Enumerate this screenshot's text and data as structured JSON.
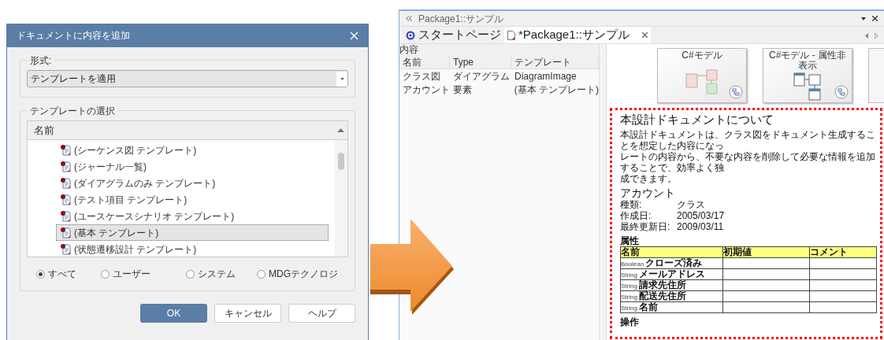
{
  "dialog": {
    "title": "ドキュメントに内容を追加",
    "format_group": {
      "label": "形式:",
      "dropdown_value": "テンプレートを適用"
    },
    "template_group": {
      "label": "テンプレートの選択",
      "column": "名前",
      "items": [
        {
          "label": "(シーケンス図 テンプレート)",
          "selected": false
        },
        {
          "label": "(ジャーナル一覧)",
          "selected": false
        },
        {
          "label": "(ダイアグラムのみ テンプレート)",
          "selected": false
        },
        {
          "label": "(テスト項目 テンプレート)",
          "selected": false
        },
        {
          "label": "(ユースケースシナリオ テンプレート)",
          "selected": false
        },
        {
          "label": "(基本 テンプレート)",
          "selected": true
        },
        {
          "label": "(状態遷移設計 テンプレート)",
          "selected": false
        }
      ],
      "filters": [
        {
          "label": "すべて",
          "selected": true
        },
        {
          "label": "ユーザー",
          "selected": false
        },
        {
          "label": "システム",
          "selected": false
        },
        {
          "label": "MDGテクノロジ",
          "selected": false
        }
      ]
    },
    "buttons": [
      {
        "label": "OK",
        "kind": "primary"
      },
      {
        "label": "キャンセル",
        "kind": "normal"
      },
      {
        "label": "ヘルプ",
        "kind": "normal"
      }
    ]
  },
  "window": {
    "title": "Package1::サンプル",
    "tabs": [
      {
        "label": "スタートページ",
        "selected": false,
        "kind": "start"
      },
      {
        "label": "*Package1::サンプル",
        "selected": true,
        "kind": "document"
      }
    ],
    "contents_pane": {
      "title": "内容",
      "columns": [
        "名前",
        "Type",
        "テンプレート"
      ],
      "rows": [
        [
          "クラス図",
          "ダイアグラム",
          "DiagramImage"
        ],
        [
          "アカウント",
          "要素",
          "(基本 テンプレート)"
        ]
      ]
    },
    "template_cards": [
      {
        "title": "C#モデル",
        "kind": "pastel"
      },
      {
        "title": "C#モデル - 属性非表示",
        "kind": "outline"
      },
      {
        "kind": "partial"
      }
    ],
    "document": {
      "heading": "本設計ドキュメントについて",
      "paragraph_lines": [
        "本設計ドキュメントは、クラス図をドキュメント生成することを想定した内容になっ",
        "レートの内容から、不要な内容を削除して必要な情報を追加することで、効率よく独",
        "成できます。"
      ],
      "element_name": "アカウント",
      "details": [
        {
          "label": "種類:",
          "value": "クラス"
        },
        {
          "label": "作成日:",
          "value": "2005/03/17"
        },
        {
          "label": "最終更新日:",
          "value": "2009/03/11"
        }
      ],
      "attributes_heading": "属性",
      "attribute_columns": [
        "名前",
        "初期値",
        "コメント"
      ],
      "attributes": [
        {
          "type": "Boolean",
          "name": "クローズ済み"
        },
        {
          "type": "String",
          "name": "メールアドレス"
        },
        {
          "type": "String",
          "name": "請求先住所"
        },
        {
          "type": "String",
          "name": "配送先住所"
        },
        {
          "type": "String",
          "name": "名前"
        }
      ],
      "operations_heading": "操作"
    }
  }
}
